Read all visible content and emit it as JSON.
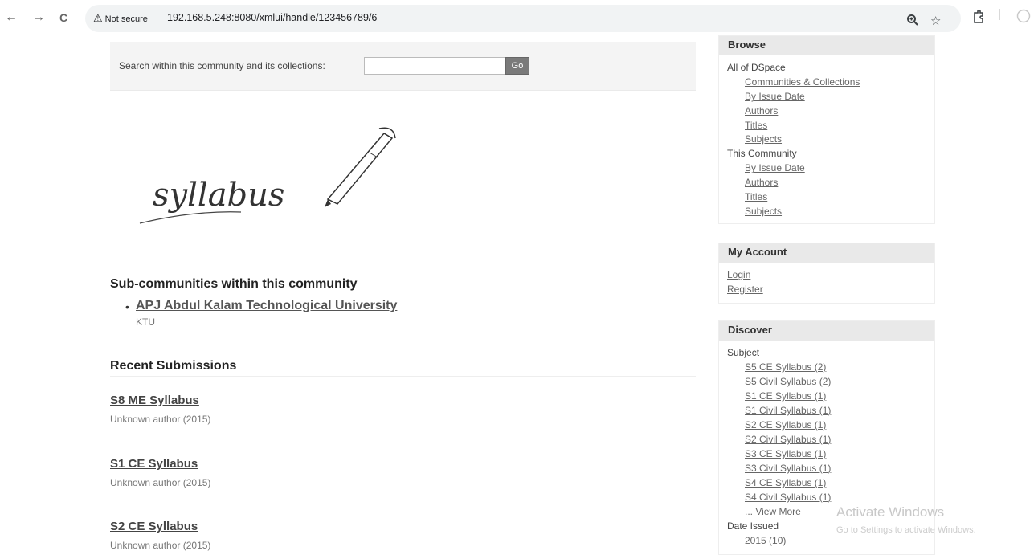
{
  "browser": {
    "back": "←",
    "forward": "→",
    "reload": "C",
    "security_text": "Not secure",
    "url": "192.168.5.248:8080/xmlui/handle/123456789/6"
  },
  "search": {
    "label": "Search within this community and its collections:",
    "value": "",
    "button": "Go"
  },
  "logo": {
    "text": "syllabus"
  },
  "subcommunities": {
    "heading": "Sub-communities within this community",
    "items": [
      {
        "name": "APJ Abdul Kalam Technological University",
        "description": "KTU"
      }
    ]
  },
  "recent": {
    "heading": "Recent Submissions",
    "items": [
      {
        "title": "S8 ME Syllabus",
        "meta": "Unknown author (2015)"
      },
      {
        "title": "S1 CE Syllabus",
        "meta": "Unknown author (2015)"
      },
      {
        "title": "S2 CE Syllabus",
        "meta": "Unknown author (2015)"
      }
    ]
  },
  "browse": {
    "heading": "Browse",
    "all_label": "All of DSpace",
    "all_links": [
      "Communities & Collections",
      "By Issue Date",
      "Authors",
      "Titles",
      "Subjects"
    ],
    "community_label": "This Community",
    "community_links": [
      "By Issue Date",
      "Authors",
      "Titles",
      "Subjects"
    ]
  },
  "account": {
    "heading": "My Account",
    "links": [
      "Login",
      "Register"
    ]
  },
  "discover": {
    "heading": "Discover",
    "subject_label": "Subject",
    "subjects": [
      "S5 CE Syllabus (2)",
      "S5 Civil Syllabus (2)",
      "S1 CE Syllabus (1)",
      "S1 Civil Syllabus (1)",
      "S2 CE Syllabus (1)",
      "S2 Civil Syllabus (1)",
      "S3 CE Syllabus (1)",
      "S3 Civil Syllabus (1)",
      "S4 CE Syllabus (1)",
      "S4 Civil Syllabus (1)"
    ],
    "view_more": "... View More",
    "date_label": "Date Issued",
    "dates": [
      "2015 (10)"
    ]
  },
  "watermark": {
    "line1": "Activate Windows",
    "line2": "Go to Settings to activate Windows."
  },
  "icons": [
    "back-arrow-icon",
    "forward-arrow-icon",
    "reload-icon",
    "warning-icon",
    "zoom-icon",
    "star-icon",
    "extensions-icon",
    "pen-icon"
  ]
}
